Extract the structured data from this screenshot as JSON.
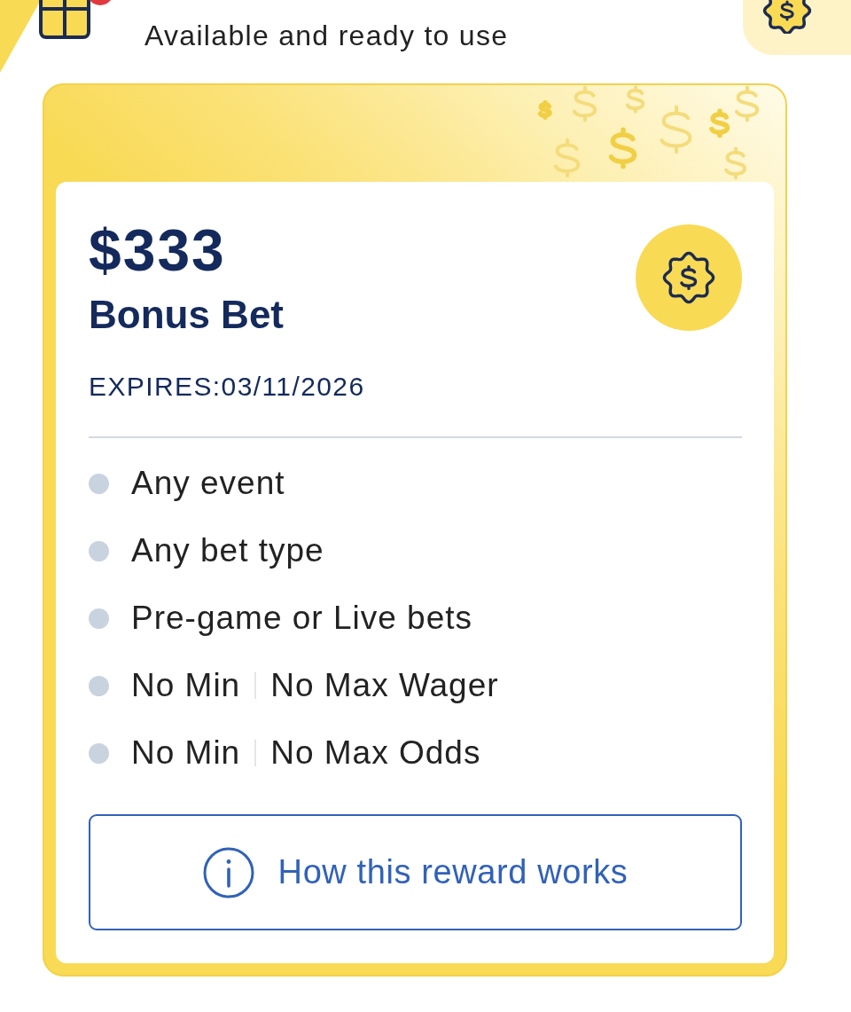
{
  "header": {
    "subtitle": "Available and ready to use",
    "has_notification": true
  },
  "reward": {
    "amount": "$333",
    "type": "Bonus Bet",
    "expires": "EXPIRES:03/11/2026",
    "features": [
      {
        "parts": [
          "Any event"
        ]
      },
      {
        "parts": [
          "Any bet type"
        ]
      },
      {
        "parts": [
          "Pre-game or Live bets"
        ]
      },
      {
        "parts": [
          "No Min",
          "No Max Wager"
        ]
      },
      {
        "parts": [
          "No Min",
          "No Max Odds"
        ]
      }
    ],
    "button": "How this reward works"
  }
}
